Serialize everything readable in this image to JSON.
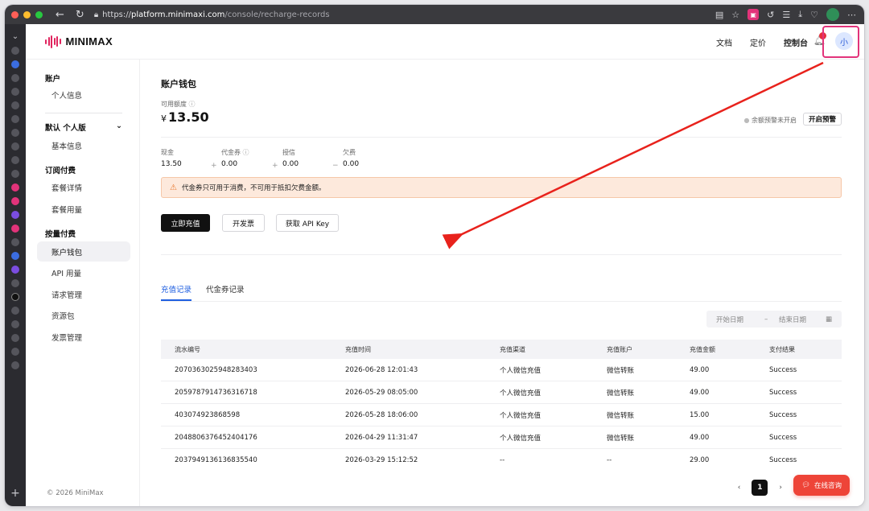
{
  "browser": {
    "url_scheme": "https://",
    "url_host": "platform.minimaxi.com",
    "url_path": "/console/recharge-records"
  },
  "header": {
    "logo_text": "MINIMAX",
    "links": [
      "文档",
      "定价",
      "控制台"
    ],
    "avatar_text": "小",
    "brand_color": "#e0245e"
  },
  "sidebar": {
    "section_account": "账户",
    "item_profile": "个人信息",
    "org_select": "默认 个人版",
    "item_basic": "基本信息",
    "section_subscription": "订阅付费",
    "item_plan_detail": "套餐详情",
    "item_plan_usage": "套餐用量",
    "section_payg": "按量付费",
    "item_wallet": "账户钱包",
    "item_api_usage": "API 用量",
    "item_requests": "请求管理",
    "item_packages": "资源包",
    "item_invoices": "发票管理",
    "copyright": "© 2026 MiniMax"
  },
  "wallet": {
    "title": "账户钱包",
    "available_label": "可用额度",
    "currency": "¥",
    "available_value": "13.50",
    "alert_status": "余额预警未开启",
    "alert_button": "开启预警",
    "metrics": [
      {
        "label": "现金",
        "value": "13.50"
      },
      {
        "label": "代金券",
        "value": "0.00"
      },
      {
        "label": "授信",
        "value": "0.00"
      },
      {
        "label": "欠费",
        "value": "0.00"
      }
    ],
    "op_plus": "+",
    "op_minus": "−",
    "notice": "代金券只可用于消费，不可用于抵扣欠费金额。",
    "btn_recharge": "立即充值",
    "btn_invoice": "开发票",
    "btn_apikey": "获取 API Key"
  },
  "records": {
    "tabs": [
      "充值记录",
      "代金券记录"
    ],
    "start_date_placeholder": "开始日期",
    "range_sep": "–",
    "end_date_placeholder": "结束日期",
    "columns": [
      "流水编号",
      "充值时间",
      "充值渠道",
      "充值账户",
      "充值金额",
      "支付结果"
    ],
    "rows": [
      [
        "2070363025948283403",
        "2026-06-28 12:01:43",
        "个人微信充值",
        "微信转账",
        "49.00",
        "Success"
      ],
      [
        "2059787914736316718",
        "2026-05-29 08:05:00",
        "个人微信充值",
        "微信转账",
        "49.00",
        "Success"
      ],
      [
        "403074923868598",
        "2026-05-28 18:06:00",
        "个人微信充值",
        "微信转账",
        "15.00",
        "Success"
      ],
      [
        "2048806376452404176",
        "2026-04-29 11:31:47",
        "个人微信充值",
        "微信转账",
        "49.00",
        "Success"
      ],
      [
        "2037949136136835540",
        "2026-03-29 15:12:52",
        "--",
        "--",
        "29.00",
        "Success"
      ]
    ],
    "page_prev": "‹",
    "page_current": "1",
    "page_next": "›"
  },
  "chat": {
    "label": "在线咨询"
  },
  "colors": {
    "accent_blue": "#1f5fe0",
    "notice_bg": "#fde9dc",
    "chat_red": "#ee4438",
    "annotation_red": "#e8221c"
  }
}
